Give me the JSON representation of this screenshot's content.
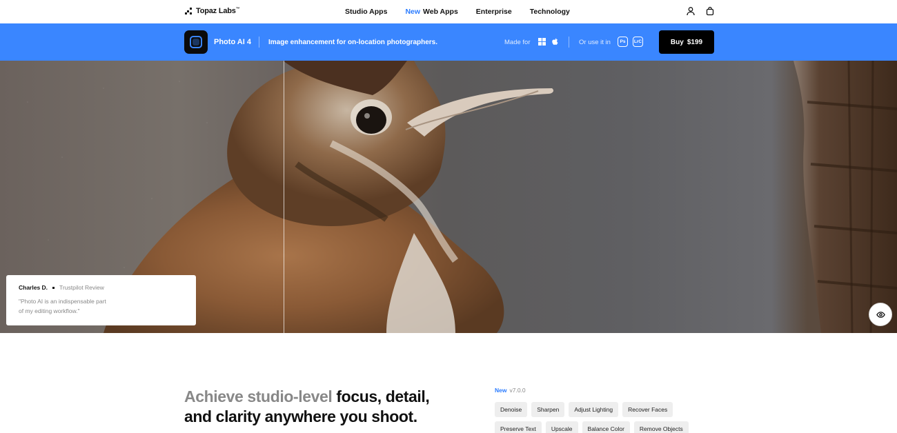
{
  "nav": {
    "logo": "Topaz Labs",
    "logo_tm": "™",
    "links": [
      {
        "label": "Studio Apps",
        "badge": ""
      },
      {
        "label": "Web Apps",
        "badge": "New"
      },
      {
        "label": "Enterprise",
        "badge": ""
      },
      {
        "label": "Technology",
        "badge": ""
      }
    ],
    "icons": [
      "user-icon",
      "shopping-bag-icon"
    ]
  },
  "product_bar": {
    "name": "Photo AI 4",
    "tagline": "Image enhancement for on-location photographers.",
    "made_for": "Made for",
    "os_icons": [
      "windows-icon",
      "apple-icon"
    ],
    "use_it_in": "Or use it in",
    "plugins": [
      "Ps",
      "LrC"
    ],
    "buy_label": "Buy",
    "price": "$199",
    "bar_color": "#3a86ff"
  },
  "hero": {
    "review": {
      "name": "Charles D.",
      "source": "Trustpilot Review",
      "quote": "\"Photo AI is an indispensable part of my editing workflow.\""
    },
    "eye_icon": "eye-icon"
  },
  "section": {
    "headline_muted": "Achieve studio-level",
    "headline_strong_1": "focus, detail,",
    "headline_strong_2": "and clarity anywhere you shoot.",
    "version_badge": "New",
    "version": "v7.0.0",
    "features": [
      "Denoise",
      "Sharpen",
      "Adjust Lighting",
      "Recover Faces",
      "Preserve Text",
      "Upscale",
      "Balance Color",
      "Remove Objects"
    ]
  }
}
